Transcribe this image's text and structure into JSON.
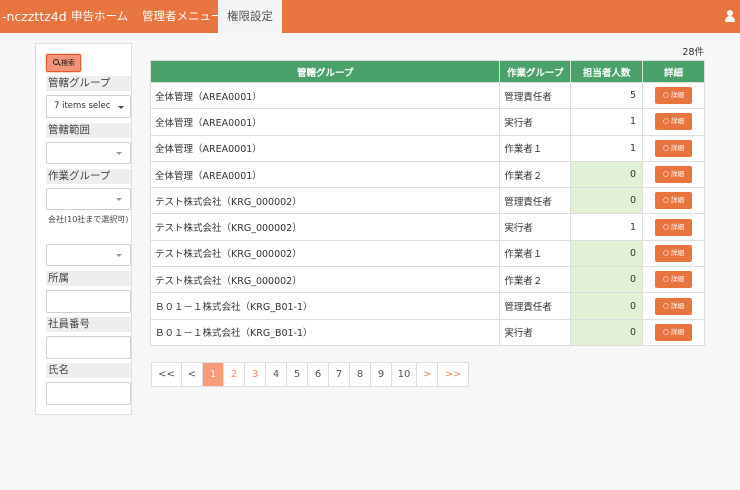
{
  "header": {
    "brand": "-nczzttz4d",
    "nav": [
      {
        "label": "申告ホーム",
        "active": false
      },
      {
        "label": "管理者メニュー",
        "active": false
      },
      {
        "label": "権限設定",
        "active": true
      }
    ],
    "user_icon": "user-icon"
  },
  "sidebar": {
    "search_label": "検索",
    "filters": {
      "kankatsu_group_label": "管轄グループ",
      "kankatsu_group_value": "7 items selec",
      "kankatsu_range_label": "管轄範囲",
      "work_group_label": "作業グループ",
      "company_label": "会社(10社まで選択可)",
      "department_label": "所属",
      "employee_no_label": "社員番号",
      "name_label": "氏名"
    }
  },
  "table": {
    "count_text": "28件",
    "headers": [
      "管轄グループ",
      "作業グループ",
      "担当者人数",
      "詳細"
    ],
    "detail_label": "詳細",
    "rows": [
      {
        "group": "全体管理（AREA0001）",
        "work_group": "管理責任者",
        "count": "5"
      },
      {
        "group": "全体管理（AREA0001）",
        "work_group": "実行者",
        "count": "1"
      },
      {
        "group": "全体管理（AREA0001）",
        "work_group": "作業者１",
        "count": "1"
      },
      {
        "group": "全体管理（AREA0001）",
        "work_group": "作業者２",
        "count": "0"
      },
      {
        "group": "テスト株式会社（KRG_000002）",
        "work_group": "管理責任者",
        "count": "0"
      },
      {
        "group": "テスト株式会社（KRG_000002）",
        "work_group": "実行者",
        "count": "1"
      },
      {
        "group": "テスト株式会社（KRG_000002）",
        "work_group": "作業者１",
        "count": "0"
      },
      {
        "group": "テスト株式会社（KRG_000002）",
        "work_group": "作業者２",
        "count": "0"
      },
      {
        "group": "Ｂ０１－１株式会社（KRG_B01-1）",
        "work_group": "管理責任者",
        "count": "0"
      },
      {
        "group": "Ｂ０１－１株式会社（KRG_B01-1）",
        "work_group": "実行者",
        "count": "0"
      }
    ],
    "zero_highlight_color": "#e2f1d5",
    "header_color": "#4ba16a"
  },
  "pagination": {
    "items": [
      {
        "label": "<<",
        "state": "normal"
      },
      {
        "label": "<",
        "state": "normal"
      },
      {
        "label": "1",
        "state": "active"
      },
      {
        "label": "2",
        "state": "orange"
      },
      {
        "label": "3",
        "state": "orange"
      },
      {
        "label": "4",
        "state": "normal"
      },
      {
        "label": "5",
        "state": "normal"
      },
      {
        "label": "6",
        "state": "normal"
      },
      {
        "label": "7",
        "state": "normal"
      },
      {
        "label": "8",
        "state": "normal"
      },
      {
        "label": "9",
        "state": "normal"
      },
      {
        "label": "10",
        "state": "normal"
      },
      {
        "label": ">",
        "state": "orange"
      },
      {
        "label": ">>",
        "state": "orange"
      }
    ]
  },
  "colors": {
    "accent": "#e8743f",
    "active_page": "#f79c77"
  }
}
